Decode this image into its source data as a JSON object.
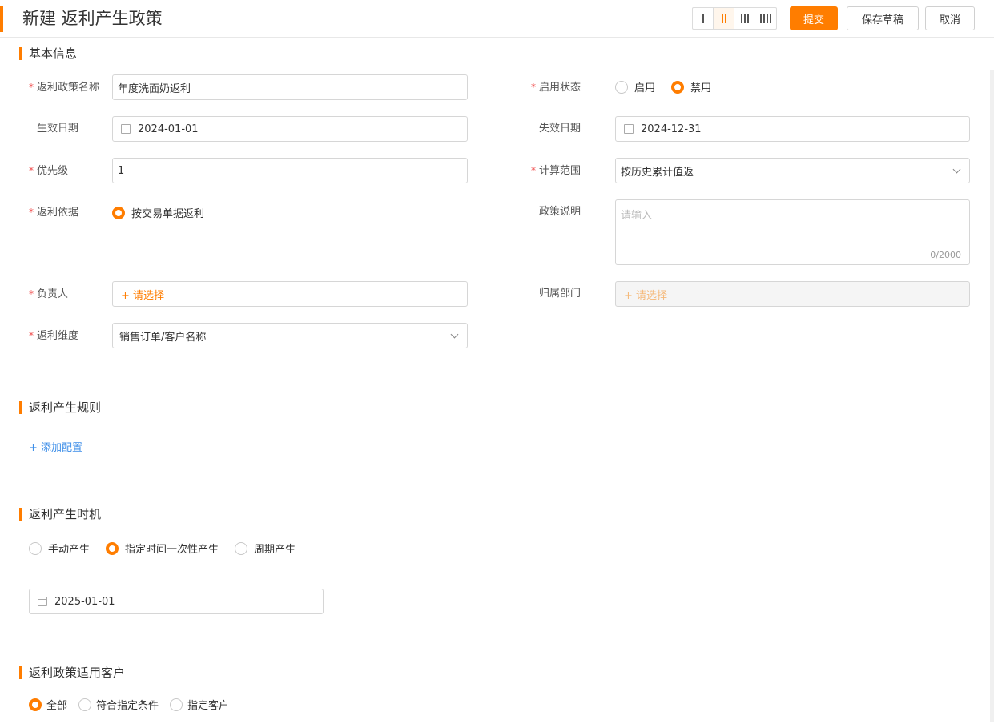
{
  "header": {
    "title": "新建 返利产生政策",
    "submit_label": "提交",
    "save_draft_label": "保存草稿",
    "cancel_label": "取消",
    "layout_options": [
      "1",
      "2",
      "3",
      "4"
    ],
    "active_layout": "2"
  },
  "basic": {
    "section_title": "基本信息",
    "policy_name": {
      "label": "返利政策名称",
      "value": "年度洗面奶返利"
    },
    "status": {
      "label": "启用状态",
      "options": [
        "启用",
        "禁用"
      ],
      "selected": "禁用"
    },
    "effective_date": {
      "label": "生效日期",
      "value": "2024-01-01"
    },
    "expiry_date": {
      "label": "失效日期",
      "value": "2024-12-31"
    },
    "priority": {
      "label": "优先级",
      "value": "1"
    },
    "calc_scope": {
      "label": "计算范围",
      "value": "按历史累计值返"
    },
    "basis": {
      "label": "返利依据",
      "options": [
        "按交易单据返利"
      ],
      "selected": "按交易单据返利"
    },
    "description": {
      "label": "政策说明",
      "placeholder": "请输入",
      "count": "0/2000"
    },
    "owner": {
      "label": "负责人",
      "placeholder": "+ 请选择"
    },
    "department": {
      "label": "归属部门",
      "placeholder": "+ 请选择"
    },
    "dimension": {
      "label": "返利维度",
      "value": "销售订单/客户名称"
    }
  },
  "rules": {
    "section_title": "返利产生规则",
    "add_label": "+ 添加配置"
  },
  "timing": {
    "section_title": "返利产生时机",
    "options": [
      "手动产生",
      "指定时间一次性产生",
      "周期产生"
    ],
    "selected": "指定时间一次性产生",
    "date": "2025-01-01"
  },
  "customers": {
    "section_title": "返利政策适用客户",
    "options": [
      "全部",
      "符合指定条件",
      "指定客户"
    ],
    "selected": "全部"
  },
  "colors": {
    "accent": "#ff7d00",
    "required": "#f04848",
    "link": "#3d8ee8"
  }
}
